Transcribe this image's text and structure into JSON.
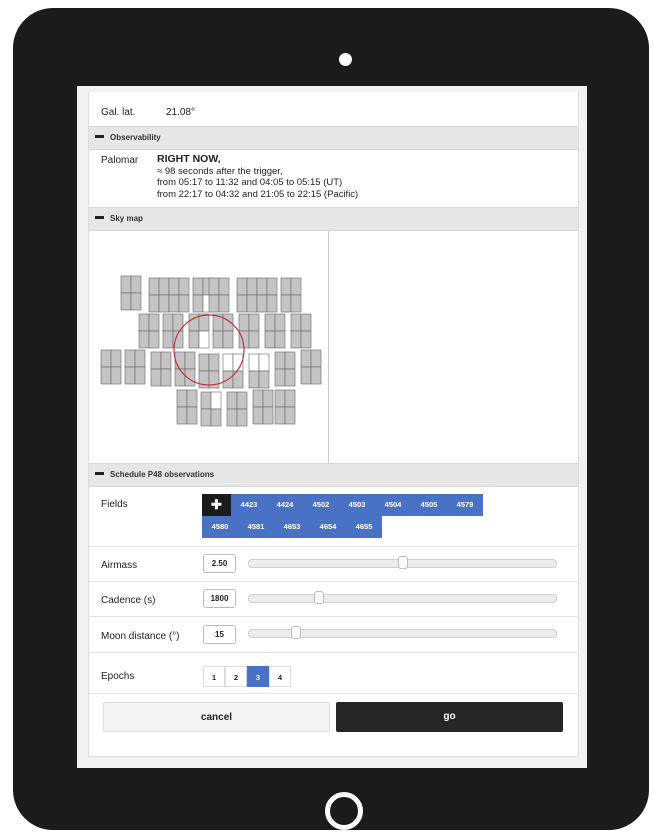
{
  "galactic": {
    "label": "Gal. lat.",
    "value": "21.08°"
  },
  "observability": {
    "header": "Observability",
    "site": "Palomar",
    "now": "RIGHT NOW,",
    "lines": [
      "≈ 98 seconds after the trigger,",
      "from 05:17 to 11:32 and 04:05 to 05:15 (UT)",
      "from 22:17 to 04:32 and 21:05 to 22:15 (Pacific)"
    ]
  },
  "skymap": {
    "header": "Sky map"
  },
  "schedule": {
    "header": "Schedule P48 observations",
    "fields_label": "Fields",
    "add_symbol": "✚",
    "fields": [
      "4423",
      "4424",
      "4502",
      "4503",
      "4504",
      "4505",
      "4579",
      "4580",
      "4581",
      "4653",
      "4654",
      "4655"
    ],
    "airmass": {
      "label": "Airmass",
      "value": "2.50",
      "level": 0.5
    },
    "cadence": {
      "label": "Cadence (s)",
      "value": "1800",
      "level": 0.22
    },
    "moon": {
      "label": "Moon distance (°)",
      "value": "15",
      "level": 0.14
    },
    "epochs": {
      "label": "Epochs",
      "options": [
        "1",
        "2",
        "3",
        "4"
      ],
      "selected": "3"
    },
    "cancel_label": "cancel",
    "go_label": "go"
  },
  "colors": {
    "accent": "#4a72c4",
    "dark": "#262626",
    "header_bg": "#e6e6e6",
    "circle": "#c0323a"
  }
}
